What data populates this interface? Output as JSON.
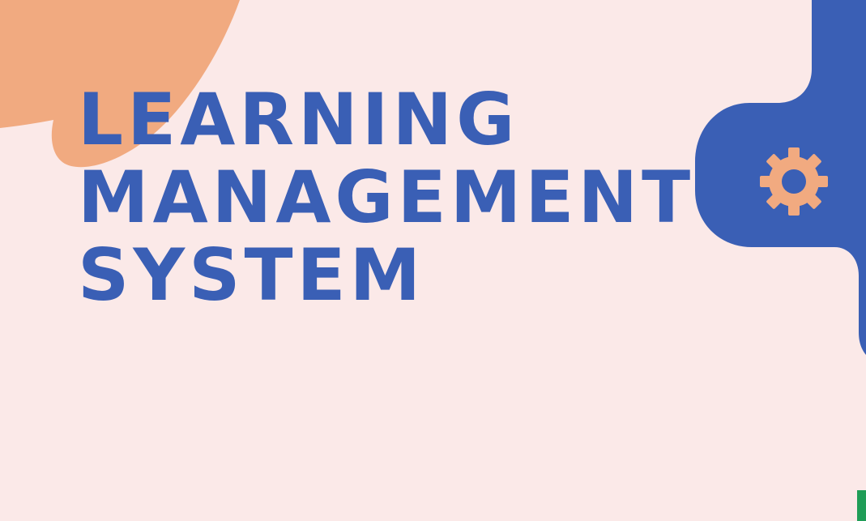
{
  "slide": {
    "title_lines": [
      "LEARNING",
      "MANAGEMENT",
      "SYSTEM"
    ]
  },
  "colors": {
    "background": "#fbe9e8",
    "title": "#3a5fb5",
    "peach_blob": "#f1aa80",
    "blue_blob": "#3a5fb5",
    "gear": "#f1aa80",
    "corner_mark": "#1f9d57"
  },
  "icons": {
    "gear": "gear-icon"
  }
}
